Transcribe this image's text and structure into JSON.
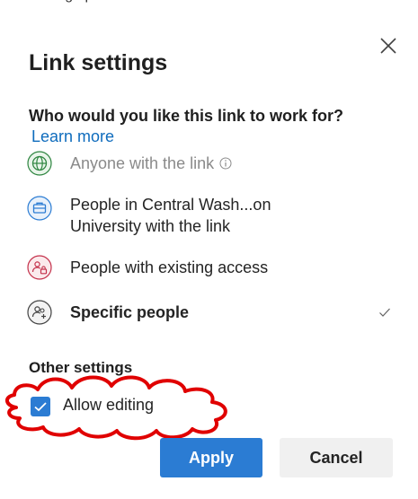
{
  "dialog": {
    "title": "Link settings",
    "question": "Who would you like this link to work for?",
    "learn_more": "Learn more",
    "options": [
      {
        "label": "Anyone with the link",
        "icon": "globe-icon",
        "color": "#2e8540",
        "state": "disabled"
      },
      {
        "label": "People in Central Wash...on University with the link",
        "icon": "briefcase-icon",
        "color": "#2b7cd3"
      },
      {
        "label": "People with existing access",
        "icon": "people-lock-icon",
        "color": "#c4314b"
      },
      {
        "label": "Specific people",
        "icon": "people-add-icon",
        "color": "#424242",
        "selected": true
      }
    ],
    "other_settings": "Other settings",
    "allow_editing": {
      "label": "Allow editing",
      "checked": true
    },
    "apply_label": "Apply",
    "cancel_label": "Cancel"
  },
  "colors": {
    "accent": "#2b7cd3",
    "link": "#0f6cbd",
    "annotation": "#e00000"
  }
}
